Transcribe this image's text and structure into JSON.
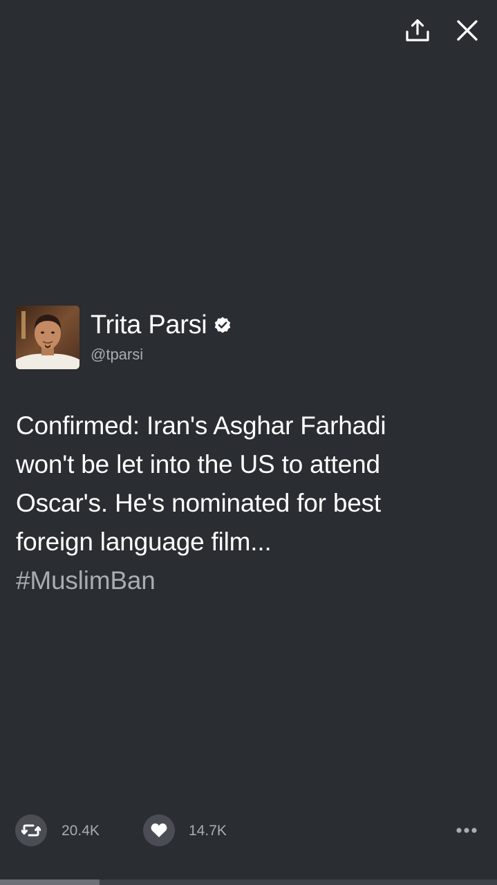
{
  "toolbar": {
    "share_icon": "share-upload-icon",
    "close_icon": "close-icon"
  },
  "author": {
    "display_name": "Trita Parsi",
    "handle": "@tparsi",
    "verified": true,
    "avatar": "avatar-photo"
  },
  "tweet": {
    "lines": [
      "Confirmed: Iran's Asghar Farhadi",
      "won't be let into the US to attend",
      "Oscar's. He's nominated for best",
      "foreign language film..."
    ],
    "hashtag": "#MuslimBan"
  },
  "actions": {
    "retweet_icon": "retweet-icon",
    "retweet_count": "20.4K",
    "like_icon": "heart-icon",
    "like_count": "14.7K",
    "more_icon": "more-dots-icon"
  },
  "progress": {
    "fraction": 0.2
  },
  "colors": {
    "background": "#2a2d31",
    "text_primary": "#ffffff",
    "text_secondary": "#a9adb3",
    "action_circle": "#4a4e54"
  }
}
